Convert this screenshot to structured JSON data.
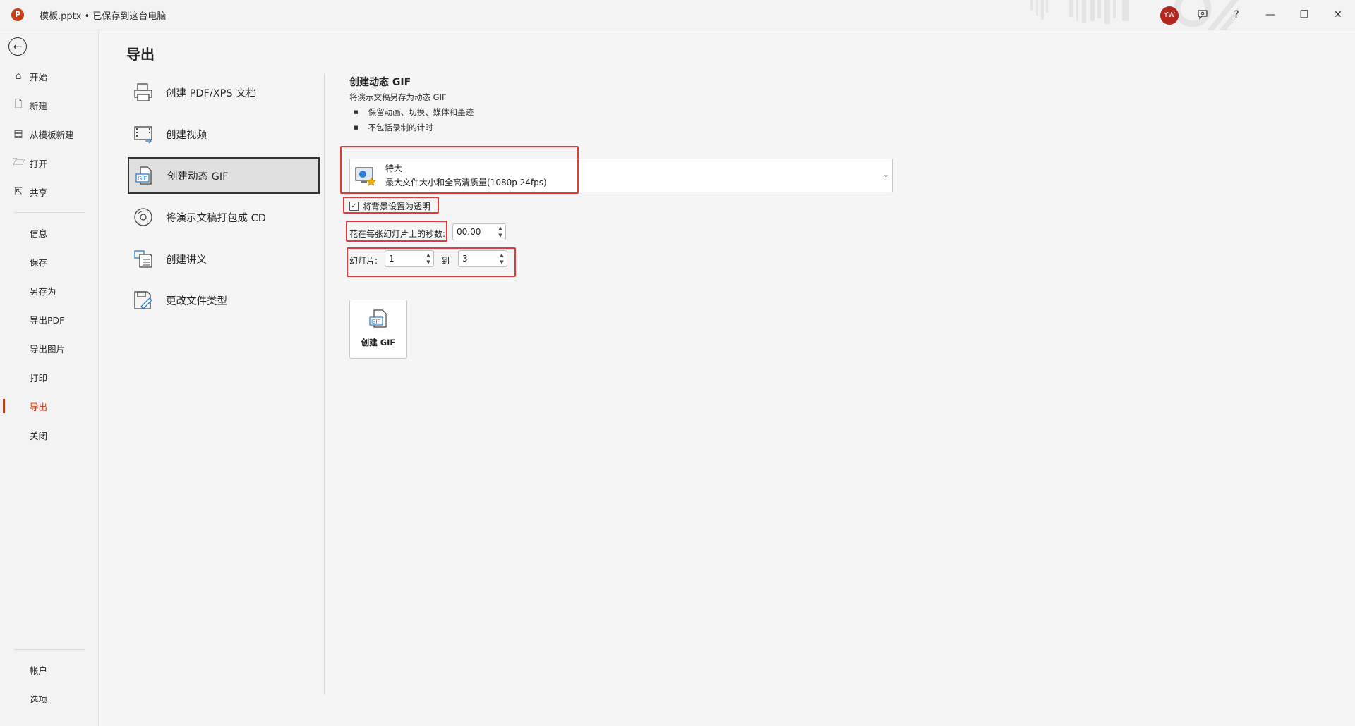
{
  "titlebar": {
    "logo_letter": "P",
    "document_title": "模板.pptx • 已保存到这台电脑",
    "avatar_initials": "YW",
    "help_glyph": "?",
    "minimize_glyph": "—",
    "restore_glyph": "❐",
    "close_glyph": "✕"
  },
  "nav": {
    "back_glyph": "←",
    "primary": [
      {
        "label": "开始",
        "icon": "home-icon"
      },
      {
        "label": "新建",
        "icon": "new-file-icon"
      },
      {
        "label": "从模板新建",
        "icon": "template-icon"
      },
      {
        "label": "打开",
        "icon": "folder-icon"
      },
      {
        "label": "共享",
        "icon": "share-icon"
      }
    ],
    "secondary": [
      "信息",
      "保存",
      "另存为",
      "导出PDF",
      "导出图片",
      "打印",
      "导出",
      "关闭"
    ],
    "active": "导出",
    "bottom": [
      "帐户",
      "选项"
    ]
  },
  "main": {
    "title": "导出",
    "options": [
      {
        "label": "创建 PDF/XPS 文档",
        "icon": "pdf-icon"
      },
      {
        "label": "创建视频",
        "icon": "video-icon"
      },
      {
        "label": "创建动态 GIF",
        "icon": "gif-icon",
        "selected": true
      },
      {
        "label": "将演示文稿打包成 CD",
        "icon": "cd-icon"
      },
      {
        "label": "创建讲义",
        "icon": "handout-icon"
      },
      {
        "label": "更改文件类型",
        "icon": "change-type-icon"
      }
    ]
  },
  "gif_panel": {
    "title": "创建动态 GIF",
    "description": "将演示文稿另存为动态 GIF",
    "bullets": [
      "保留动画、切换、媒体和墨迹",
      "不包括录制的计时"
    ],
    "quality": {
      "name": "特大",
      "detail": "最大文件大小和全高清质量(1080p 24fps)"
    },
    "transparent_bg": {
      "label": "将背景设置为透明",
      "checked": true
    },
    "seconds": {
      "label": "花在每张幻灯片上的秒数:",
      "value": "00.00"
    },
    "slides": {
      "label": "幻灯片:",
      "from": "1",
      "to_label": "到",
      "to": "3"
    },
    "create_button": {
      "label": "创建 GIF"
    }
  },
  "colors": {
    "accent": "#c43e1c",
    "highlight": "#e03a3a"
  }
}
